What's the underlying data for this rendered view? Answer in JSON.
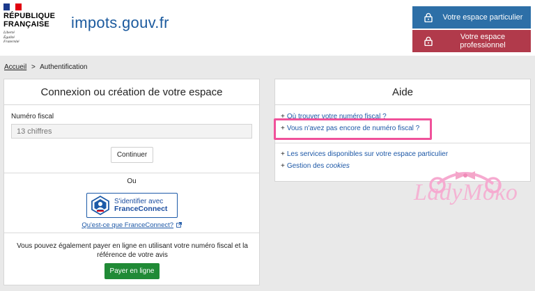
{
  "header": {
    "republique_line1": "RÉPUBLIQUE",
    "republique_line2": "FRANÇAISE",
    "motto": [
      "Liberté",
      "Égalité",
      "Fraternité"
    ],
    "logo_main": "impots",
    "logo_domain": ".gouv.fr",
    "btn_particulier": "Votre espace particulier",
    "btn_professionnel": "Votre espace professionnel",
    "colors": {
      "particulier": "#2d6fa7",
      "professionnel": "#b13a4b",
      "logo": "#1b5a9e"
    }
  },
  "breadcrumb": {
    "home": "Accueil",
    "separator": ">",
    "current": "Authentification"
  },
  "login": {
    "title": "Connexion ou création de votre espace",
    "fiscal_label": "Numéro fiscal",
    "fiscal_placeholder": "13 chiffres",
    "continue_label": "Continuer",
    "or_label": "Ou",
    "fc_line1": "S'identifier avec",
    "fc_line2": "FranceConnect",
    "fc_link": "Qu'est-ce que FranceConnect?",
    "pay_text": "Vous pouvez également payer en ligne en utilisant votre numéro fiscal et la référence de votre avis",
    "pay_button": "Payer en ligne",
    "pay_color": "#208a36"
  },
  "aide": {
    "title": "Aide",
    "links": [
      {
        "prefix": "+",
        "text": "Où trouver votre numéro fiscal ?"
      },
      {
        "prefix": "+",
        "text": "Vous n'avez pas encore de numéro fiscal ?"
      },
      {
        "prefix": "+",
        "text": "Les services disponibles sur votre espace particulier"
      },
      {
        "prefix": "+",
        "text": "Gestion des",
        "italic": "cookies"
      }
    ],
    "highlight_color": "#f0519a"
  },
  "watermark": {
    "text": "LadyMoko"
  }
}
